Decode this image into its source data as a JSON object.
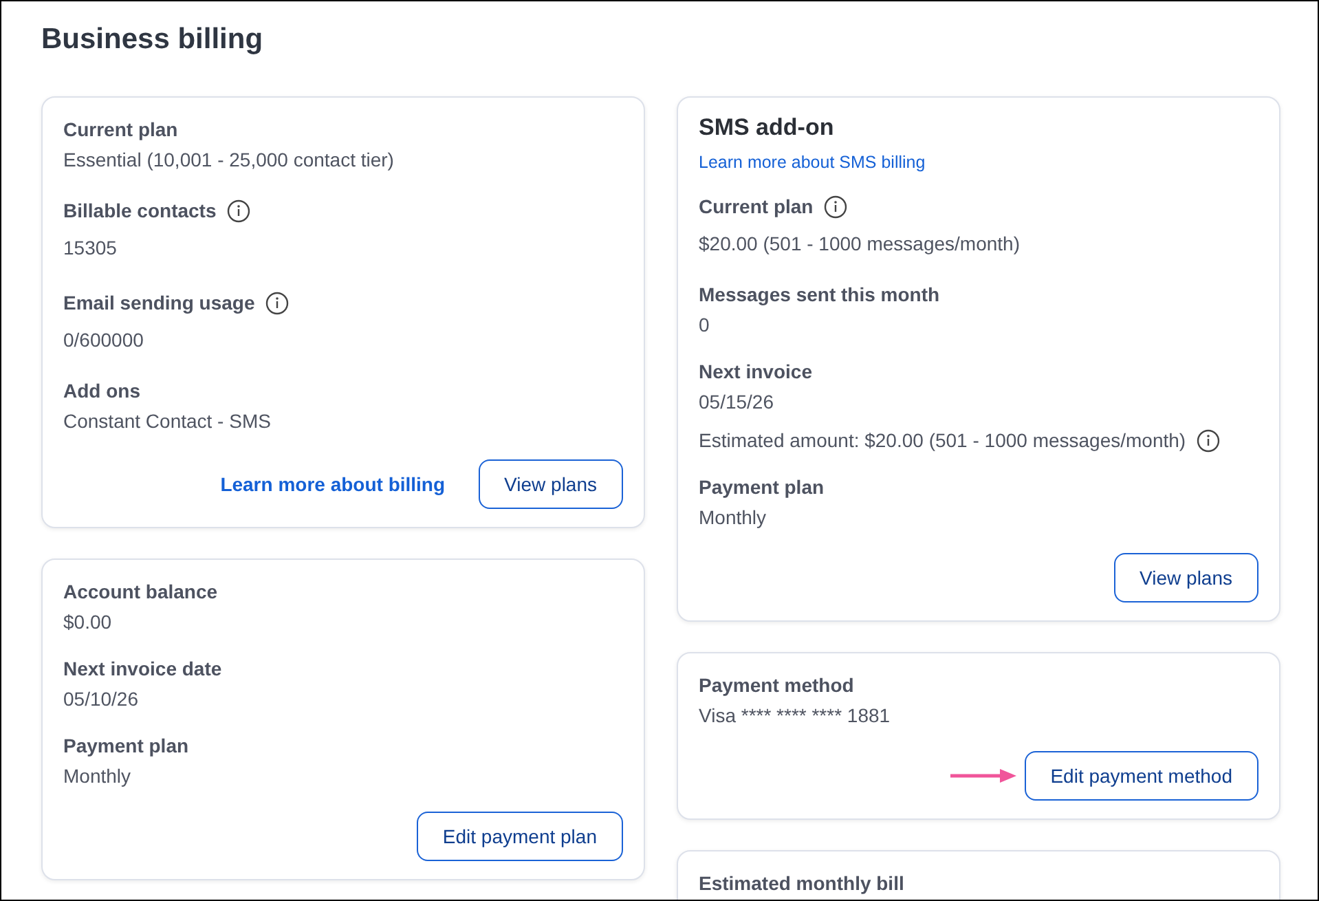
{
  "page_title": "Business billing",
  "left_cards": [
    {
      "fields": [
        {
          "label": "Current plan",
          "values": [
            {
              "text": "Essential (10,001 - 25,000 contact tier)"
            }
          ]
        },
        {
          "label": "Billable contacts",
          "info": true,
          "values": [
            {
              "text": "15305"
            }
          ]
        },
        {
          "label": "Email sending usage",
          "info": true,
          "values": [
            {
              "text": "0/600000"
            }
          ]
        },
        {
          "label": "Add ons",
          "values": [
            {
              "text": "Constant Contact - SMS"
            }
          ]
        }
      ],
      "link": "Learn more about billing",
      "button": "View plans"
    },
    {
      "fields": [
        {
          "label": "Account balance",
          "values": [
            {
              "text": "$0.00"
            }
          ]
        },
        {
          "label": "Next invoice date",
          "values": [
            {
              "text": "05/10/26"
            }
          ]
        },
        {
          "label": "Payment plan",
          "values": [
            {
              "text": "Monthly"
            }
          ]
        }
      ],
      "button": "Edit payment plan"
    }
  ],
  "right_cards": [
    {
      "heading": "SMS add-on",
      "top_link": "Learn more about SMS billing",
      "fields": [
        {
          "label": "Current plan",
          "info": true,
          "values": [
            {
              "text": "$20.00 (501 - 1000 messages/month)"
            }
          ]
        },
        {
          "label": "Messages sent this month",
          "values": [
            {
              "text": "0"
            }
          ]
        },
        {
          "label": "Next invoice",
          "values": [
            {
              "text": "05/15/26"
            },
            {
              "text": "Estimated amount: $20.00 (501 - 1000 messages/month)",
              "info": true
            }
          ]
        },
        {
          "label": "Payment plan",
          "values": [
            {
              "text": "Monthly"
            }
          ]
        }
      ],
      "button": "View plans"
    },
    {
      "fields": [
        {
          "label": "Payment method",
          "values": [
            {
              "text": "Visa **** **** **** 1881"
            }
          ]
        }
      ],
      "button": "Edit payment method",
      "pointer_arrow": true
    },
    {
      "fields": [
        {
          "label": "Estimated monthly bill"
        }
      ]
    }
  ]
}
